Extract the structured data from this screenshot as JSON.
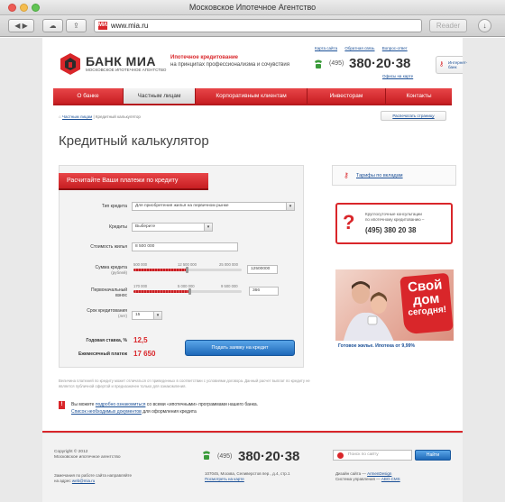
{
  "window": {
    "title": "Московское Ипотечное Агентство"
  },
  "browser": {
    "url": "www.mia.ru",
    "favicon": "МИА",
    "reader_label": "Reader"
  },
  "header": {
    "logo_name": "БАНК МИА",
    "logo_sub": "МОСКОВСКОЕ ИПОТЕЧНОЕ АГЕНТСТВО",
    "tagline_1": "Ипотечное кредитование",
    "tagline_2": "на принципах профессионализма и сочувствия",
    "links": [
      "Карта сайта",
      "Обратная связь",
      "Вопрос-ответ"
    ],
    "phone_code": "(495)",
    "phone_number": "380·20·38",
    "offices_link": "Офисы на карте",
    "ibank_label_1": "Интернет-",
    "ibank_label_2": "банк"
  },
  "nav": [
    {
      "label": "О банке",
      "active": false
    },
    {
      "label": "Частным лицам",
      "active": true
    },
    {
      "label": "Корпоративным клиентам",
      "active": false
    },
    {
      "label": "Инвесторам",
      "active": false
    },
    {
      "label": "Контакты",
      "active": false
    }
  ],
  "breadcrumb": {
    "link": "Частным лицам",
    "sep": " | ",
    "current": "Кредитный калькулятор"
  },
  "print_button": "Распечатать страницу",
  "page_title": "Кредитный калькулятор",
  "calculator": {
    "header": "Расчитайте Ваши платежи по кредиту",
    "loan_type_label": "Тип кредита",
    "loan_type_value": "Для приобретения жилья на первичном рынке",
    "credits_label": "Кредиты",
    "credits_value": "Выберите",
    "property_cost_label": "Стоимость жилья",
    "property_cost_value": "8 500 000",
    "loan_amount_label": "Сумма кредита",
    "loan_amount_unit": "(рублей)",
    "loan_amount_scale": [
      "500 000",
      "12 500 000",
      "25 000 000"
    ],
    "loan_amount_value": "12500000",
    "loan_amount_fraction": 0.49,
    "down_payment_label_1": "Первоначальный",
    "down_payment_label_2": "взнос",
    "down_payment_scale": [
      "170 000",
      "5 000 000",
      "9 500 000"
    ],
    "down_payment_value": "366",
    "down_payment_fraction": 0.52,
    "term_label": "Срок кредитования",
    "term_unit": "(лет)",
    "term_value": "15",
    "rate_label": "Годовая ставка, %",
    "rate_value": "12,5",
    "payment_label": "Ежемесячный платеж",
    "payment_value": "17 650",
    "apply_button": "Подать заявку на кредит"
  },
  "note": "Величина платежей по кредиту может отличаться от приведенных в соответствии с условиями договора. Данный расчет выплат по кредиту не является публичной офертой и предназначен только для ознакомления.",
  "info": {
    "line1_pre": "Вы можете ",
    "line1_link": "подробно ознакомиться",
    "line1_post": " со всеми «ипотечными» программами нашего банка.",
    "line2_link": "Список необходимых документов",
    "line2_post": " для оформления кредита"
  },
  "sidebar": {
    "tariffs_link": "Тарифы по вкладам",
    "consult_text_1": "Круглосуточные консультации",
    "consult_text_2": "по ипотечному кредитованию –",
    "consult_phone": "(495) 380 20 38",
    "promo_word_1": "Свой",
    "promo_word_2": "дом",
    "promo_word_3": "сегодня!",
    "promo_caption": "Готовое жилье. Ипотека от 9,99%"
  },
  "footer": {
    "copyright": "Copyright © 2012",
    "copyright_sub": "Московское ипотечное агентство",
    "mail_text_1": "Замечания по работе сайта направляйте",
    "mail_text_2_pre": "на адрес ",
    "mail_link": "web@mia.ru",
    "phone_code": "(495)",
    "phone_number": "380·20·38",
    "address": "107045, Москва, Селиверстов пер., д.4, стр.1",
    "map_link": "Посмотреть на карте",
    "search_placeholder": "Поиск по сайту",
    "search_button": "Найти",
    "design_pre": "Дизайн сайта — ",
    "design_link": "ArmenDesign",
    "cms_pre": "Система управления — ",
    "cms_link": "ABO.CMS"
  },
  "colors": {
    "brand_red": "#d9262a",
    "link_blue": "#1a4f96",
    "button_blue": "#1e68b8"
  }
}
